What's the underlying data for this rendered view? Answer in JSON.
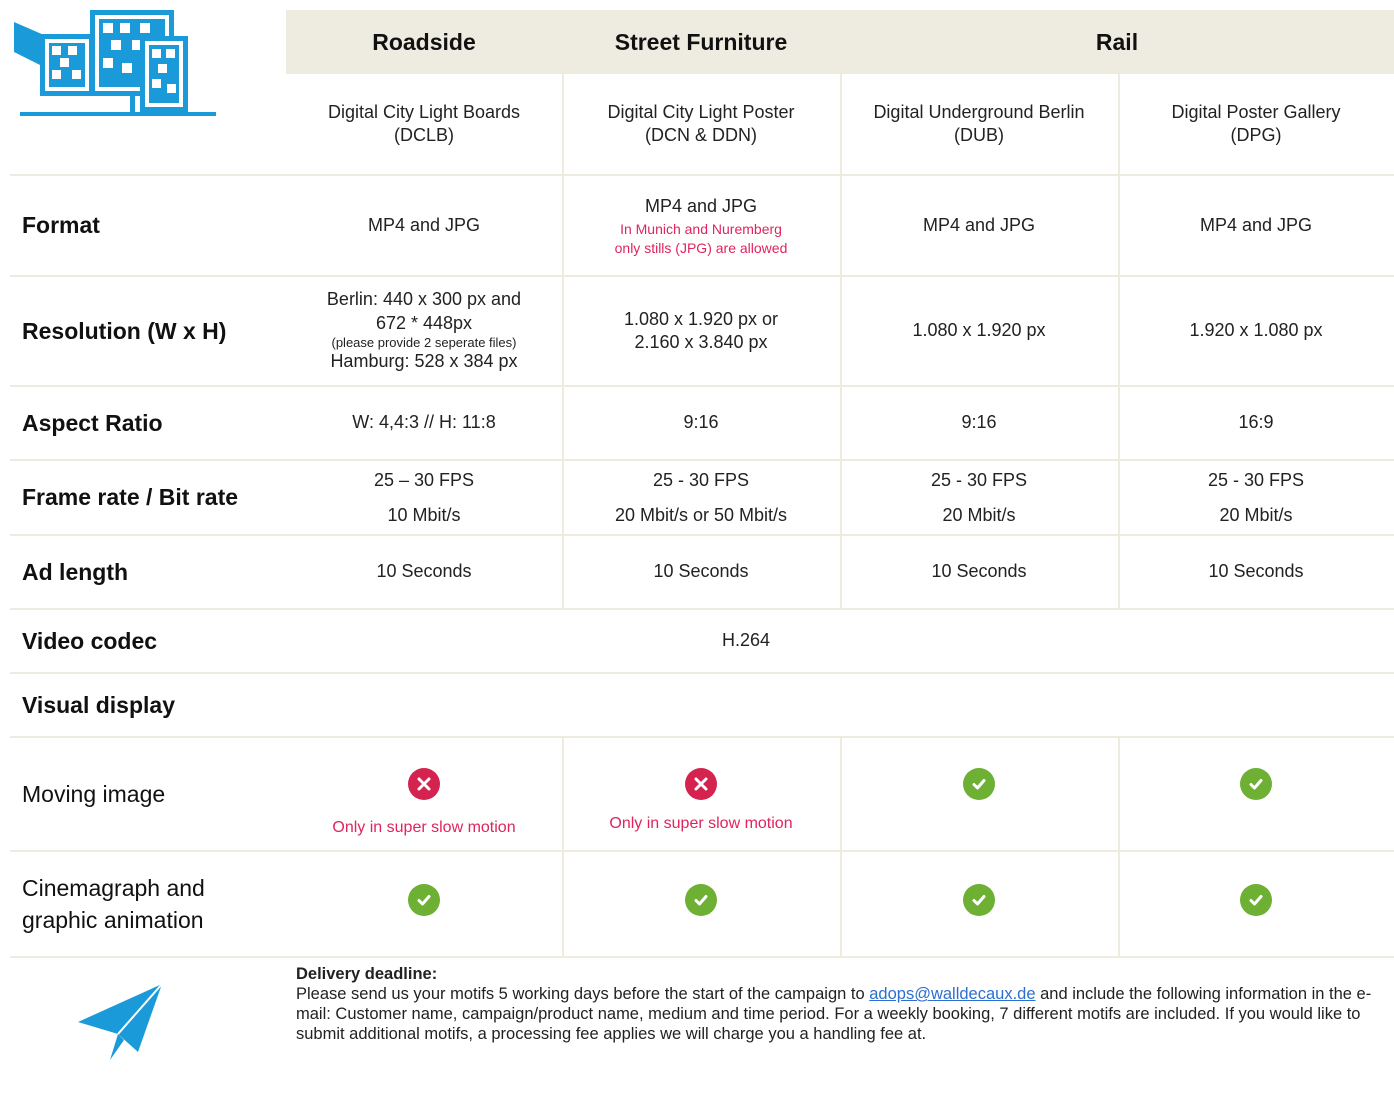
{
  "header": {
    "groups": [
      "Roadside",
      "Street Furniture",
      "Rail"
    ]
  },
  "products": [
    {
      "name": "Digital City Light Boards",
      "code": "(DCLB)"
    },
    {
      "name": "Digital City Light Poster",
      "code": "(DCN & DDN)"
    },
    {
      "name": "Digital Underground Berlin",
      "code": "(DUB)"
    },
    {
      "name": "Digital Poster Gallery",
      "code": "(DPG)"
    }
  ],
  "rows": {
    "format": {
      "label": "Format",
      "values": [
        "MP4 and JPG",
        "MP4 and JPG",
        "MP4 and JPG",
        "MP4 and JPG"
      ],
      "note_line1": "In Munich and Nuremberg",
      "note_line2": "only stills (JPG) are allowed"
    },
    "resolution": {
      "label": "Resolution (W x H)",
      "c1": [
        "Berlin: 440 x 300 px and",
        "672 * 448px",
        "(please provide 2 seperate files)",
        "Hamburg: 528 x 384 px"
      ],
      "c2": [
        "1.080 x 1.920 px or",
        "2.160 x 3.840 px"
      ],
      "c3": "1.080 x 1.920 px",
      "c4": "1.920 x 1.080 px"
    },
    "aspect": {
      "label": "Aspect Ratio",
      "values": [
        "W: 4,4:3 // H: 11:8",
        "9:16",
        "9:16",
        "16:9"
      ]
    },
    "framerate": {
      "label": "Frame rate / Bit rate",
      "fps": [
        "25 – 30 FPS",
        "25 - 30 FPS",
        "25 - 30 FPS",
        "25 - 30 FPS"
      ],
      "bitrate": [
        "10 Mbit/s",
        "20 Mbit/s or 50 Mbit/s",
        "20 Mbit/s",
        "20 Mbit/s"
      ]
    },
    "adlength": {
      "label": "Ad length",
      "values": [
        "10 Seconds",
        "10 Seconds",
        "10 Seconds",
        "10 Seconds"
      ]
    },
    "codec": {
      "label": "Video codec",
      "value": "H.264"
    },
    "visual": {
      "label": "Visual display"
    },
    "moving": {
      "label": "Moving image",
      "status": [
        "not-allowed",
        "not-allowed",
        "allowed",
        "allowed"
      ],
      "note": "Only in super slow motion"
    },
    "cinemagraph": {
      "label_line1": "Cinemagraph and",
      "label_line2": "graphic animation",
      "status": [
        "allowed",
        "allowed",
        "allowed",
        "allowed"
      ]
    }
  },
  "footer": {
    "title": "Delivery deadline:",
    "text_before": "Please send us your motifs 5 working days before the start of the campaign to ",
    "email": "adops@walldecaux.de",
    "text_after": " and include the following information in the e-mail: Customer name, campaign/product name, medium and time period. For a weekly booking, 7 different motifs are included. If you would like to submit additional motifs, a processing fee applies we will charge you a handling fee at."
  },
  "colors": {
    "accent_blue": "#1a9ad9",
    "header_band": "#eeebe1",
    "not_allowed": "#d4234f",
    "allowed": "#6eb033",
    "note_pink": "#e0245e"
  },
  "icons": {
    "logo": "digital-screens-logo-icon",
    "paper_plane": "paper-plane-icon",
    "check": "check-circle-icon",
    "cross": "x-circle-icon"
  }
}
